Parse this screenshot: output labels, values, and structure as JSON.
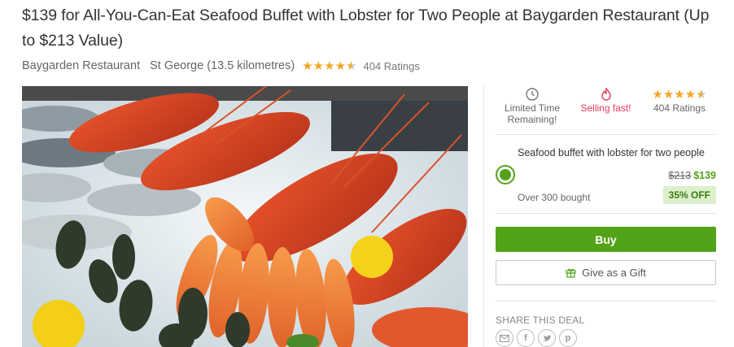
{
  "deal": {
    "title": "$139 for All-You-Can-Eat Seafood Buffet with Lobster for Two People at Baygarden Restaurant (Up to $213 Value)",
    "merchant": "Baygarden Restaurant",
    "location": "St George (13.5 kilometres)",
    "rating_stars": 4.5,
    "ratings_count": "404 Ratings"
  },
  "hero_image": {
    "subject": "seafood-buffet-photo"
  },
  "badges": {
    "time": {
      "icon": "clock-icon",
      "label": "Limited Time Remaining!"
    },
    "fast": {
      "icon": "flame-icon",
      "label": "Selling fast!"
    },
    "rating": {
      "label": "404 Ratings"
    }
  },
  "option": {
    "title": "Seafood buffet with lobster for two people",
    "original_price": "$213",
    "price": "$139",
    "bought": "Over 300 bought",
    "discount": "35% OFF"
  },
  "actions": {
    "buy_label": "Buy",
    "gift_label": "Give as a Gift"
  },
  "share": {
    "label": "SHARE THIS DEAL",
    "icons": [
      "email-icon",
      "facebook-icon",
      "twitter-icon",
      "pinterest-icon"
    ]
  },
  "colors": {
    "accent_green": "#53a318",
    "star": "#f5a623",
    "selling_fast": "#e8385c"
  }
}
